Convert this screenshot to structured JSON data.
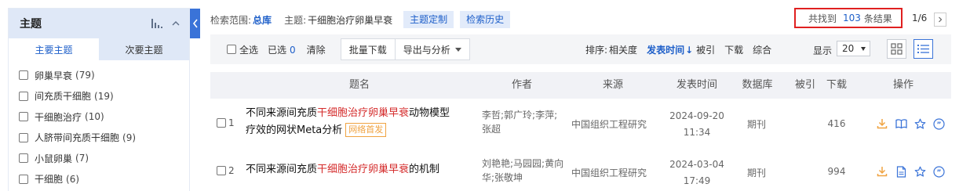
{
  "sidebar": {
    "title": "主题",
    "tabs": [
      {
        "label": "主要主题"
      },
      {
        "label": "次要主题"
      }
    ],
    "items": [
      {
        "label": "卵巢早衰",
        "count": "(79)"
      },
      {
        "label": "间充质干细胞",
        "count": "(19)"
      },
      {
        "label": "干细胞治疗",
        "count": "(10)"
      },
      {
        "label": "人脐带间充质干细胞",
        "count": "(9)"
      },
      {
        "label": "小鼠卵巢",
        "count": "(7)"
      },
      {
        "label": "干细胞",
        "count": "(6)"
      }
    ]
  },
  "search": {
    "scope_label": "检索范围:",
    "scope": "总库",
    "topic_label": "主题:",
    "topic": "干细胞治疗卵巢早衰",
    "custom_btn": "主题定制",
    "history_btn": "检索历史",
    "result_prefix": "共找到",
    "result_count": "103",
    "result_suffix": "条结果",
    "page_indicator": "1/6"
  },
  "toolbar": {
    "select_all": "全选",
    "selected_label": "已选",
    "selected_count": "0",
    "clear": "清除",
    "batch_download": "批量下载",
    "export_analyze": "导出与分析",
    "sort_label": "排序:",
    "sort_options": [
      {
        "label": "相关度"
      },
      {
        "label": "发表时间"
      },
      {
        "label": "被引"
      },
      {
        "label": "下载"
      },
      {
        "label": "综合"
      }
    ],
    "sort_arrow": "↓",
    "show_label": "显示",
    "page_size": "20"
  },
  "table": {
    "headers": {
      "title": "题名",
      "author": "作者",
      "source": "来源",
      "date": "发表时间",
      "db": "数据库",
      "cited": "被引",
      "downloads": "下载",
      "ops": "操作"
    },
    "rows": [
      {
        "index": "1",
        "title_pre": "不同来源间充质",
        "title_hl": "干细胞治疗卵巢早衰",
        "title_post": "动物模型",
        "title_line2": "疗效的网状Meta分析",
        "badge": "网络首发",
        "author_line1": "李哲;郭广玲;李萍;",
        "author_line2": "张超",
        "source": "中国组织工程研究",
        "date": "2024-09-20",
        "time": "11:34",
        "db": "期刊",
        "downloads": "416"
      },
      {
        "index": "2",
        "title_pre": "不同来源间充质",
        "title_hl": "干细胞治疗卵巢早衰",
        "title_post": "的机制",
        "author_line1": "刘艳艳;马园园;黄向",
        "author_line2": "华;张敬坤",
        "source": "中国组织工程研究",
        "date": "2024-03-04",
        "time": "17:49",
        "db": "期刊",
        "downloads": "994"
      }
    ]
  },
  "colors": {
    "accent": "#1e5fc9",
    "highlight": "#d42a2a",
    "result_border": "#e02020",
    "badge": "#f0a341",
    "download_icon": "#f0a341"
  }
}
